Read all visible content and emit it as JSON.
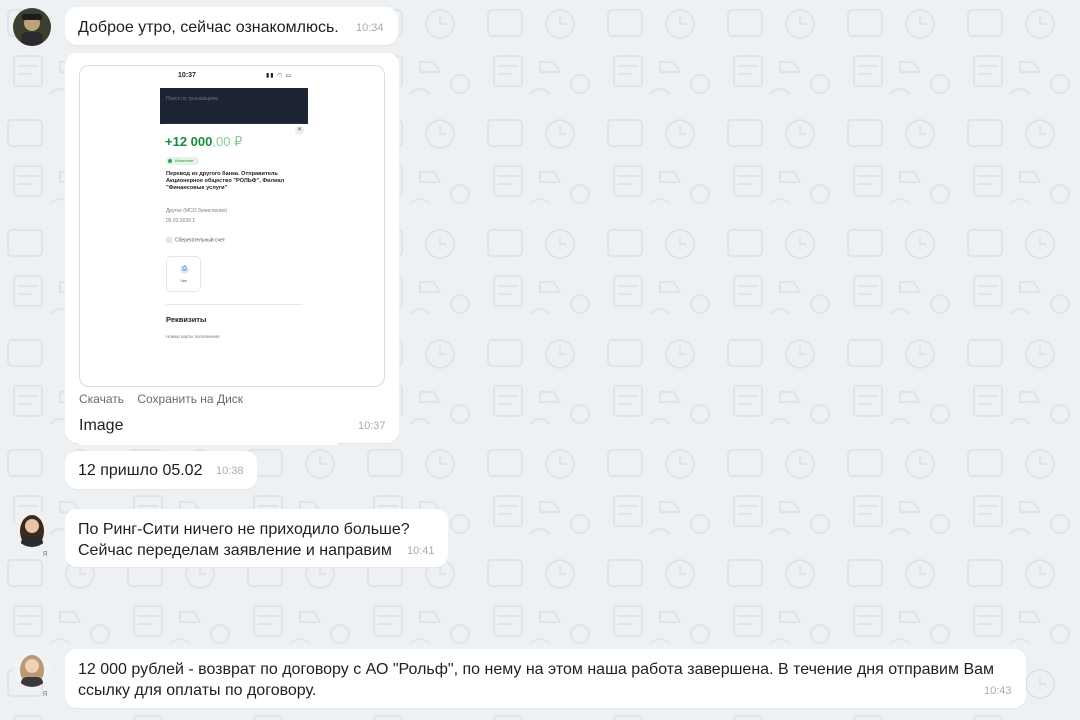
{
  "messages": [
    {
      "text": "Доброе утро, сейчас ознакомлюсь.",
      "time": "10:34"
    },
    {
      "image": {
        "status_time": "10:37",
        "search_placeholder": "Поиск по транзакциям",
        "amount_int": "+12 000",
        "amount_dec": ",00 ₽",
        "status_pill": "Исполнен",
        "description": "Перевод из другого банка. Отправитель Акционерное общество \"РОЛЬФ\", Филиал \"Финансовые услуги\"",
        "category": "Другое (МСО Зачисления)",
        "date": "05.02.2026 1",
        "account": "Сберегательный счет",
        "receipt_label": "Чек",
        "requisites": "Реквизиты",
        "card_number_label": "Номер карты пополнения"
      },
      "download_label": "Скачать",
      "save_disk_label": "Сохранить на Диск",
      "caption": "Image",
      "time": "10:37"
    },
    {
      "text": "12 пришло 05.02",
      "time": "10:38"
    },
    {
      "line1": "По Ринг-Сити ничего не приходило больше?",
      "line2": "Сейчас переделам заявление и направим",
      "time": "10:41",
      "sender_mark": "я"
    },
    {
      "line1": "12 000 рублей - возврат по договору с АО \"Рольф\", по нему на этом наша работа завершена. В течение дня отправим Вам",
      "line2": "ссылку для оплаты по договору.",
      "time": "10:43",
      "sender_mark": "я"
    }
  ],
  "colors": {
    "background": "#eef1f4",
    "bubble": "#ffffff",
    "amount_green": "#1d8a3b"
  }
}
